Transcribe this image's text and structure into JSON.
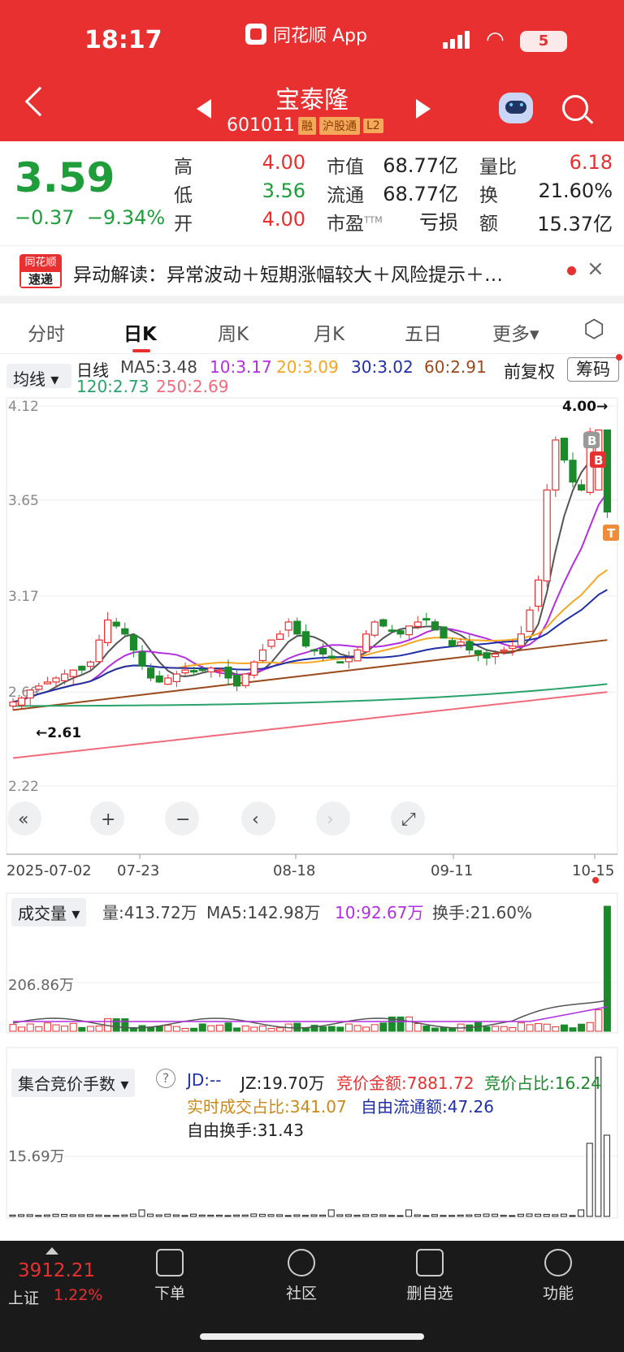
{
  "status_bar": {
    "time": "18:17",
    "app_badge": "同花顺 App",
    "battery": "5"
  },
  "header": {
    "stock_name": "宝泰隆",
    "stock_code": "601011",
    "tags": [
      "融",
      "沪股通",
      "L2"
    ]
  },
  "quote": {
    "price": "3.59",
    "change": "−0.37",
    "change_pct": "−9.34%",
    "high_label": "高",
    "high": "4.00",
    "low_label": "低",
    "low": "3.56",
    "open_label": "开",
    "open": "4.00",
    "mcap_label": "市值",
    "mcap": "68.77亿",
    "float_label": "流通",
    "float": "68.77亿",
    "pe_label": "市盈",
    "pe_sup": "TTM",
    "pe": "亏损",
    "vr_label": "量比",
    "vr": "6.18",
    "turn_label": "换",
    "turn": "21.60%",
    "amt_label": "额",
    "amt": "15.37亿"
  },
  "news": {
    "logo_top": "同花顺",
    "logo_bottom": "速递",
    "text": "异动解读：异常波动＋短期涨幅较大＋风险提示＋…",
    "close": "×"
  },
  "tabs": [
    "分时",
    "日K",
    "周K",
    "月K",
    "五日",
    "更多▾"
  ],
  "ma_row": {
    "select": "均线 ▾",
    "period": "日线",
    "ma5": "MA5:3.48",
    "ma10": "10:3.17",
    "ma20": "20:3.09",
    "ma30": "30:3.02",
    "ma60": "60:2.91",
    "ma120": "120:2.73",
    "ma250": "250:2.69",
    "fq": "前复权",
    "cm": "筹码"
  },
  "kline": {
    "y_labels": [
      "4.12",
      "3.65",
      "3.17",
      "2.69",
      "2.22"
    ],
    "high_marker": "4.00→",
    "low_marker": "←2.61",
    "dates": [
      "2025-07-02",
      "07-23",
      "08-18",
      "09-11",
      "10-15"
    ],
    "badges": [
      "B",
      "B",
      "T"
    ],
    "controls": [
      "«",
      "+",
      "−",
      "‹",
      "›",
      "⤢"
    ],
    "colors": {
      "up": "#e93030",
      "down": "#1a8a2a",
      "ma5": "#555555",
      "ma10": "#b32ee0",
      "ma20": "#f5a623",
      "ma30": "#1f2fa8",
      "ma60": "#9b4a1c",
      "ma120": "#29a36a",
      "ma250": "#f06b7c"
    }
  },
  "volume": {
    "select": "成交量 ▾",
    "vol": "量:413.72万",
    "ma5": "MA5:142.98万",
    "ma10": "10:92.67万",
    "turnover": "换手:21.60%",
    "y_label": "206.86万"
  },
  "auction": {
    "select": "集合竞价手数 ▾",
    "help": "?",
    "jd": "JD:--",
    "jz": "JZ:19.70万",
    "amount": "竞价金额:7881.72",
    "ratio": "竞价占比:16.24",
    "real_ratio": "实时成交占比:341.07",
    "free_float": "自由流通额:47.26",
    "free_turn": "自由换手:31.43",
    "y_label": "15.69万"
  },
  "bottom_nav": {
    "index_value": "3912.21",
    "index_name": "上证",
    "index_pct": "1.22%",
    "items": [
      "下单",
      "社区",
      "删自选",
      "功能"
    ]
  }
}
